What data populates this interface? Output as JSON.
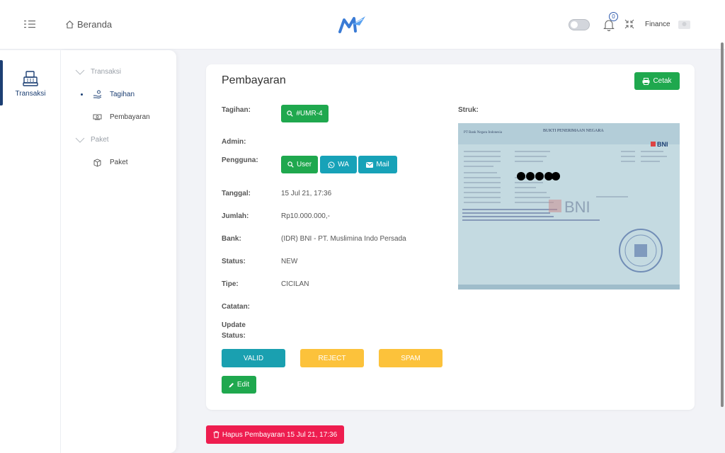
{
  "topbar": {
    "home_label": "Beranda",
    "notification_count": "0",
    "user_name": "Finance"
  },
  "rail": {
    "items": [
      {
        "label": "Transaksi",
        "icon": "cash-register-icon",
        "active": true
      }
    ]
  },
  "submenu": {
    "groups": [
      {
        "label": "Transaksi",
        "items": [
          {
            "label": "Tagihan",
            "icon": "hand-coin-icon",
            "active": true
          },
          {
            "label": "Pembayaran",
            "icon": "handshake-money-icon",
            "active": false
          }
        ]
      },
      {
        "label": "Paket",
        "items": [
          {
            "label": "Paket",
            "icon": "package-icon",
            "active": false
          }
        ]
      }
    ]
  },
  "card": {
    "title": "Pembayaran",
    "print_label": "Cetak",
    "fields": {
      "tagihan_label": "Tagihan:",
      "tagihan_value": "#UMR-4",
      "admin_label": "Admin:",
      "pengguna_label": "Pengguna:",
      "user_btn": "User",
      "wa_btn": "WA",
      "mail_btn": "Mail",
      "tanggal_label": "Tanggal:",
      "tanggal_value": "15 Jul 21, 17:36",
      "jumlah_label": "Jumlah:",
      "jumlah_value": "Rp10.000.000,-",
      "bank_label": "Bank:",
      "bank_value": "(IDR) BNI - PT. Muslimina Indo Persada",
      "status_label": "Status:",
      "status_value": "NEW",
      "tipe_label": "Tipe:",
      "tipe_value": "CICILAN",
      "catatan_label": "Catatan:",
      "update_status_label_1": "Update",
      "update_status_label_2": "Status:"
    },
    "actions": {
      "valid": "VALID",
      "reject": "REJECT",
      "spam": "SPAM",
      "edit": "Edit"
    },
    "struk_label": "Struk:",
    "receipt": {
      "bank_name": "BNI",
      "heading": "BUKTI PENERIMAAN NEGARA"
    }
  },
  "delete_label": "Hapus Pembayaran 15 Jul 21, 17:36",
  "colors": {
    "primary": "#1c3f73",
    "green": "#1fa84e",
    "teal": "#17a2b8",
    "yellow": "#fcc23b",
    "red": "#ee1d4f"
  }
}
